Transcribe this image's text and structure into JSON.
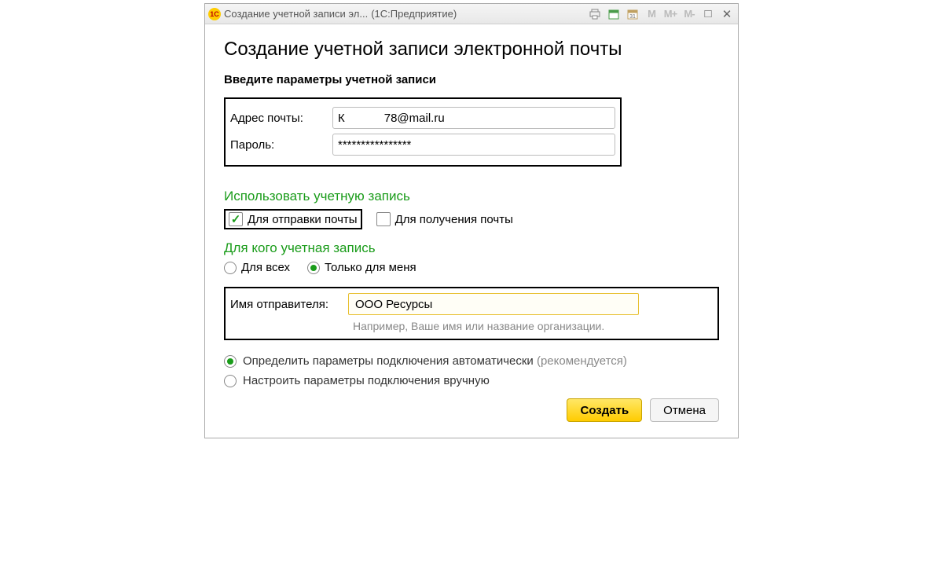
{
  "titlebar": {
    "app_initials": "1С",
    "title": "Создание учетной записи эл...",
    "subtitle": "(1С:Предприятие)",
    "m_buttons": [
      "M",
      "M+",
      "M-"
    ]
  },
  "header": {
    "title": "Создание учетной записи электронной почты",
    "subtitle": "Введите параметры учетной записи"
  },
  "fields": {
    "email_label": "Адрес почты:",
    "email_part1": "К",
    "email_part2": "78@mail.ru",
    "password_label": "Пароль:",
    "password_mask": "****************"
  },
  "use_account": {
    "heading": "Использовать учетную запись",
    "send_label": "Для отправки почты",
    "send_checked": true,
    "receive_label": "Для получения почты",
    "receive_checked": false
  },
  "for_whom": {
    "heading": "Для кого учетная запись",
    "all_label": "Для всех",
    "all_checked": false,
    "me_label": "Только для меня",
    "me_checked": true
  },
  "sender": {
    "label": "Имя отправителя:",
    "value": "ООО Ресурсы",
    "hint": "Например, Ваше имя или название организации."
  },
  "connection": {
    "auto_label": "Определить параметры подключения автоматически",
    "auto_suffix": "(рекомендуется)",
    "auto_checked": true,
    "manual_label": "Настроить параметры подключения вручную",
    "manual_checked": false
  },
  "buttons": {
    "create": "Создать",
    "cancel": "Отмена"
  }
}
